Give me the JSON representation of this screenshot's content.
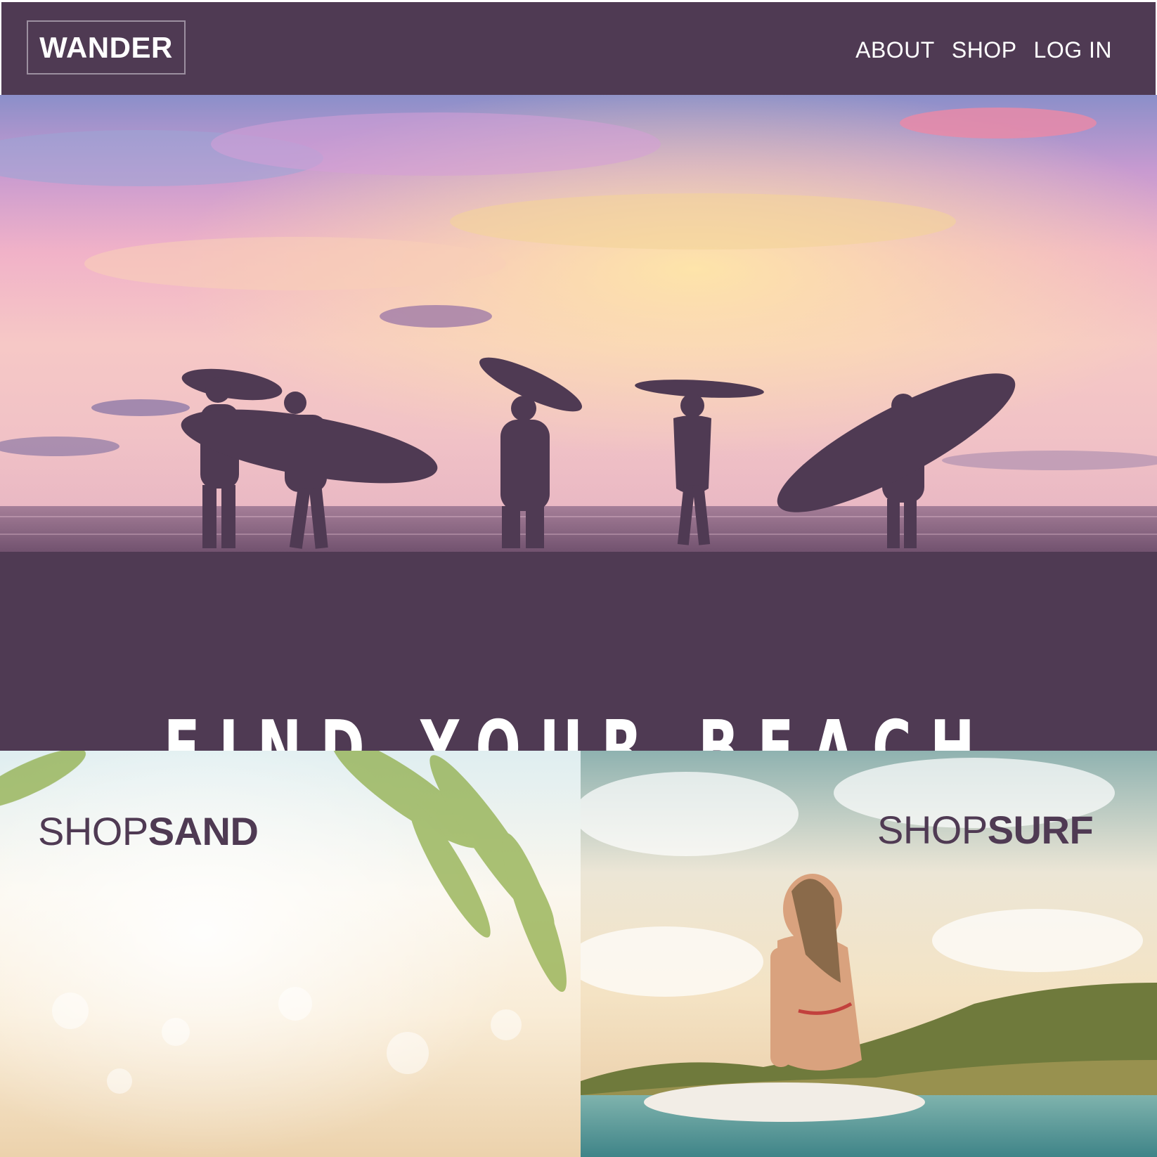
{
  "brand": {
    "logo": "WANDER"
  },
  "nav": {
    "items": [
      "ABOUT",
      "SHOP",
      "LOG IN"
    ]
  },
  "hero": {
    "title": "FIND YOUR BEACH"
  },
  "panels": {
    "sand": {
      "prefix": "SHOP",
      "emphasis": "SAND"
    },
    "surf": {
      "prefix": "SHOP",
      "emphasis": "SURF"
    }
  },
  "colors": {
    "brand": "#4f3a53",
    "text_on_brand": "#ffffff"
  },
  "icons": {
    "hero_image": "surfers-silhouette-sunset",
    "sand_image": "blurred-beach-palm",
    "surf_image": "woman-on-surfboard"
  }
}
